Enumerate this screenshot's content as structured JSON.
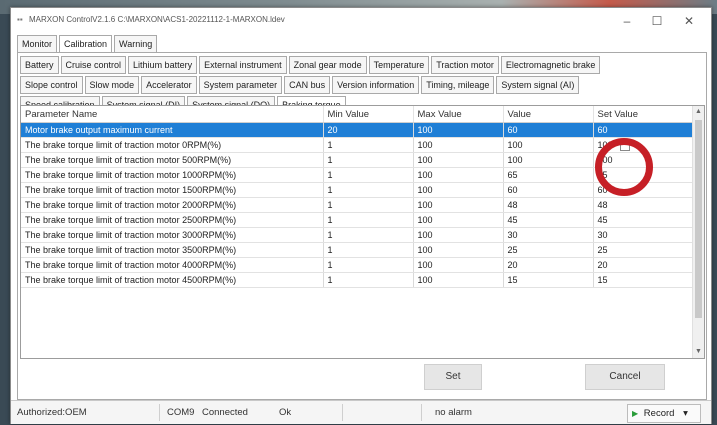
{
  "window": {
    "title": "MARXON ControlV2.1.6 C:\\MARXON\\ACS1-20221112-1-MARXON.ldev",
    "minimize": "–",
    "maximize": "☐",
    "close": "✕"
  },
  "main_tabs": [
    "Monitor",
    "Calibration",
    "Warning"
  ],
  "sub_tabs_row1": [
    "Battery",
    "Cruise control",
    "Lithium battery",
    "External instrument",
    "Zonal gear mode",
    "Temperature",
    "Traction motor",
    "Electromagnetic brake"
  ],
  "sub_tabs_row2": [
    "Slope control",
    "Slow mode",
    "Accelerator",
    "System parameter",
    "CAN bus",
    "Version information",
    "Timing, mileage",
    "System signal (AI)"
  ],
  "sub_tabs_row3": [
    "Speed calibration",
    "System signal (DI)",
    "System signal (DO)",
    "Braking torque"
  ],
  "table": {
    "headers": [
      "Parameter Name",
      "Min Value",
      "Max Value",
      "Value",
      "Set Value"
    ],
    "rows": [
      [
        "Motor brake output maximum current",
        "20",
        "100",
        "60",
        "60"
      ],
      [
        "The brake torque limit of traction motor 0RPM(%)",
        "1",
        "100",
        "100",
        "100"
      ],
      [
        "The brake torque limit of traction motor 500RPM(%)",
        "1",
        "100",
        "100",
        "100"
      ],
      [
        "The brake torque limit of traction motor 1000RPM(%)",
        "1",
        "100",
        "65",
        "65"
      ],
      [
        "The brake torque limit of traction motor 1500RPM(%)",
        "1",
        "100",
        "60",
        "60"
      ],
      [
        "The brake torque limit of traction motor 2000RPM(%)",
        "1",
        "100",
        "48",
        "48"
      ],
      [
        "The brake torque limit of traction motor 2500RPM(%)",
        "1",
        "100",
        "45",
        "45"
      ],
      [
        "The brake torque limit of traction motor 3000RPM(%)",
        "1",
        "100",
        "30",
        "30"
      ],
      [
        "The brake torque limit of traction motor 3500RPM(%)",
        "1",
        "100",
        "25",
        "25"
      ],
      [
        "The brake torque limit of traction motor 4000RPM(%)",
        "1",
        "100",
        "20",
        "20"
      ],
      [
        "The brake torque limit of traction motor 4500RPM(%)",
        "1",
        "100",
        "15",
        "15"
      ]
    ]
  },
  "buttons": {
    "set": "Set",
    "cancel": "Cancel"
  },
  "status": {
    "user": "Authorized:OEM",
    "port": "COM9",
    "connection": "Connected",
    "state": "Ok",
    "alarm": "no alarm",
    "record": "Record",
    "record_arrow": "▾",
    "record_icon": "▶"
  },
  "colors": {
    "selection": "#1f7fd6",
    "annotation_ring": "#c61f26"
  }
}
